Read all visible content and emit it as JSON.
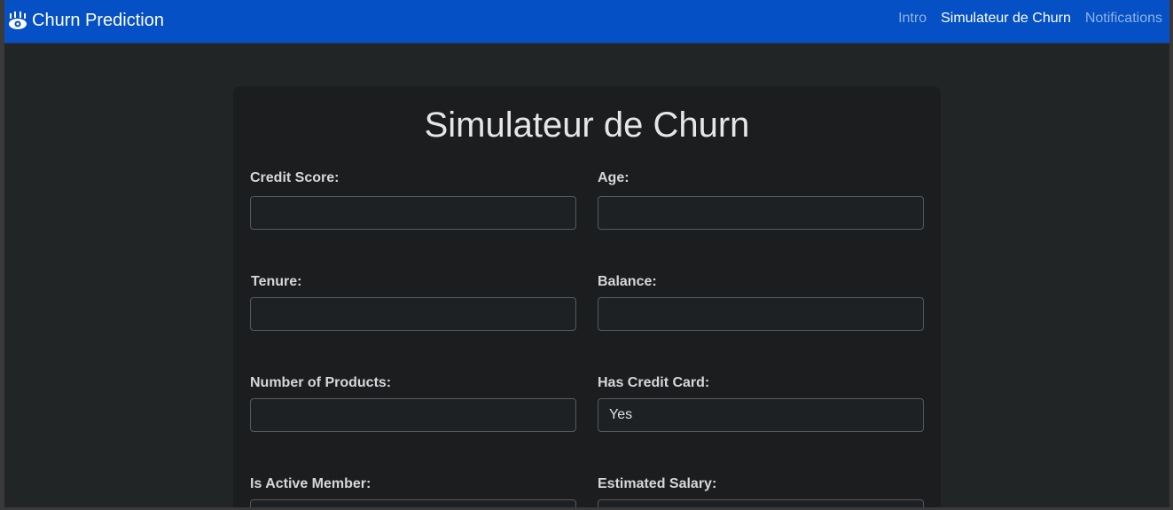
{
  "navbar": {
    "brand": "Churn Prediction",
    "brand_icon": "eye-logo-icon",
    "links": [
      {
        "label": "Intro",
        "active": false
      },
      {
        "label": "Simulateur de Churn",
        "active": true
      },
      {
        "label": "Notifications",
        "active": false
      }
    ]
  },
  "form": {
    "title": "Simulateur de Churn",
    "fields": {
      "credit_score": {
        "label": "Credit Score:",
        "value": ""
      },
      "age": {
        "label": "Age:",
        "value": ""
      },
      "tenure": {
        "label": "Tenure:",
        "value": ""
      },
      "balance": {
        "label": "Balance:",
        "value": ""
      },
      "num_products": {
        "label": "Number of Products:",
        "value": ""
      },
      "has_credit_card": {
        "label": "Has Credit Card:",
        "value": "Yes"
      },
      "is_active_member": {
        "label": "Is Active Member:",
        "value": ""
      },
      "estimated_salary": {
        "label": "Estimated Salary:",
        "value": ""
      }
    }
  },
  "colors": {
    "navbar_bg": "#0450c4",
    "page_bg": "#222526",
    "card_bg": "#1b1d1f"
  }
}
